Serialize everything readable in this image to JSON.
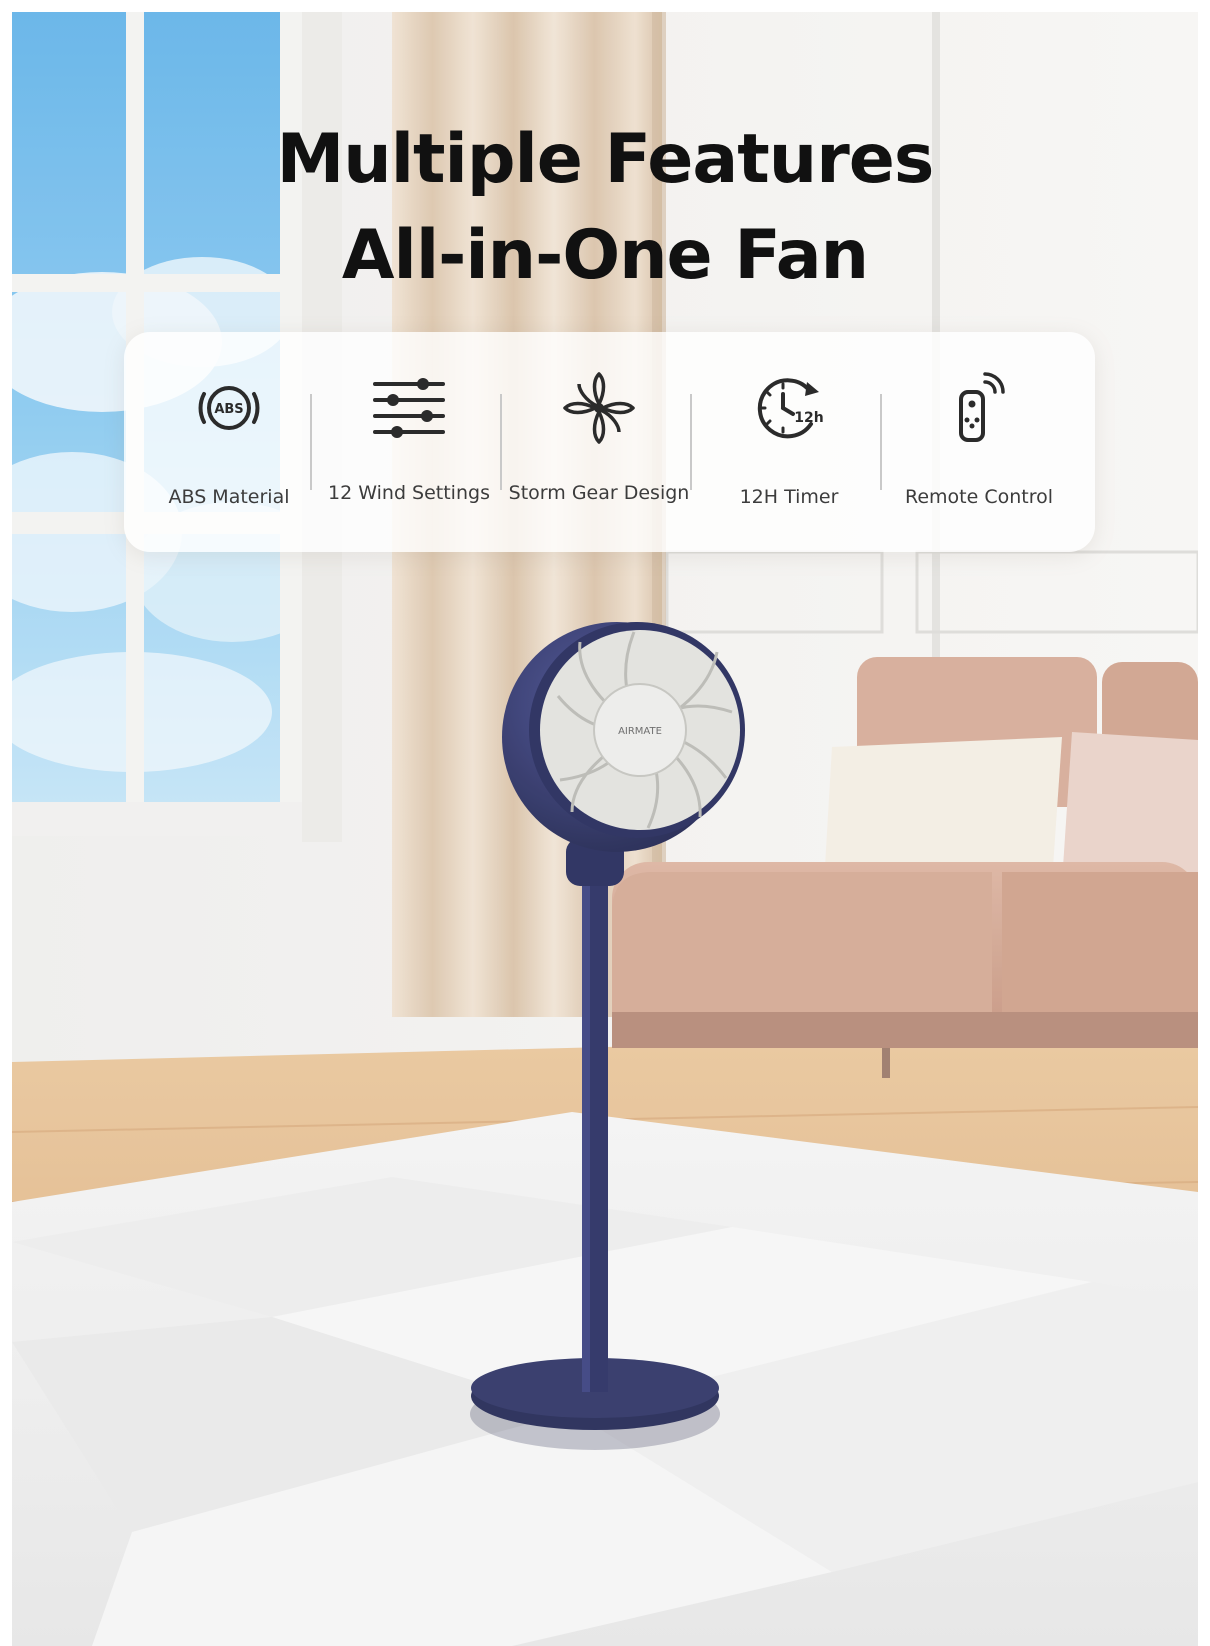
{
  "headline": {
    "line1": "Multiple Features",
    "line2": "All-in-One Fan"
  },
  "features": [
    {
      "label": "ABS Material",
      "icon": "abs-badge-icon"
    },
    {
      "label": "12 Wind Settings",
      "icon": "sliders-icon"
    },
    {
      "label": "Storm Gear Design",
      "icon": "fan-blade-icon"
    },
    {
      "label": "12H Timer",
      "icon": "timer-12h-icon",
      "icon_text": "12h"
    },
    {
      "label": "Remote Control",
      "icon": "remote-control-icon"
    }
  ],
  "abs_badge_text": "ABS",
  "product_logo_text": "AIRMATE",
  "colors": {
    "fan_body": "#2c3168",
    "sofa": "#d7ad99",
    "floor": "#e2b98b",
    "sky": "#7ec0ea",
    "curtain": "#e7d4c0",
    "wall": "#efefef"
  }
}
